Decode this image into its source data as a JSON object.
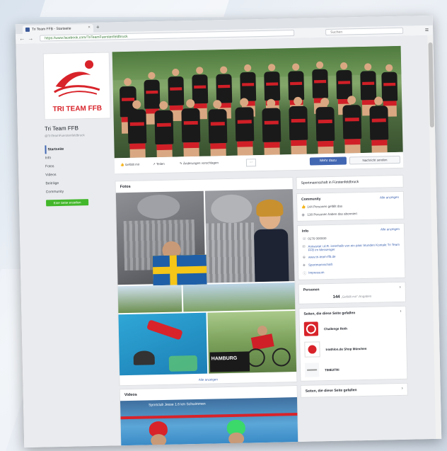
{
  "browser": {
    "tab_title": "Tri Team FFB - Startseite",
    "tab_close": "×",
    "new_tab": "+",
    "back": "←",
    "forward": "→",
    "url": "https://www.facebook.com/TriTeamFuerstenfeldbruck",
    "search_placeholder": "Suchen",
    "menu": "≡"
  },
  "sidebar": {
    "logo_text": "TRI TEAM FFB",
    "page_name": "Tri Team FFB",
    "handle": "@TriTeamFuerstenfeldbruck",
    "nav": [
      "Startseite",
      "Info",
      "Fotos",
      "Videos",
      "Beiträge",
      "Community"
    ],
    "create_button": "Eine Seite erstellen"
  },
  "actions": {
    "liked": "Gefällt mir",
    "share": "Teilen",
    "suggest": "Änderungen vorschlagen",
    "more": "···",
    "mehr_dazu": "Mehr dazu",
    "message": "Nachricht senden"
  },
  "photos": {
    "title": "Fotos",
    "show_all": "Alle anzeigen",
    "sign_text": "HAMBURG"
  },
  "videos": {
    "title": "Videos",
    "caption": "Sportclub Jesse 1.6 km Schwimmen"
  },
  "right": {
    "category": "Sportmannschaft in Fürstenfeldbruck",
    "community": {
      "title": "Community",
      "link": "Alle anzeigen",
      "likes": "144 Personen gefällt das",
      "follows": "138 Personen haben das abonniert"
    },
    "info": {
      "title": "Info",
      "link": "Alle anzeigen",
      "phone": "0176 000000",
      "reply": "Antwortet i.d.R. innerhalb von ein paar Stunden Kontakt Tri Team FFB im Messenger",
      "website": "www.tri-team-ffb.de",
      "category": "Sportmannschaft",
      "imprint": "Impressum"
    },
    "people": {
      "title": "Personen",
      "count": "144",
      "count_label": "„Gefällt mir“-Angaben"
    },
    "liked_pages": {
      "title": "Seiten, die diese Seite gefallen",
      "items": [
        "Challenge Roth",
        "triathlon.de Shop München",
        "TIME2TRI"
      ]
    },
    "liked_pages_2": {
      "title": "Seiten, die diese Seite gefallen"
    }
  },
  "colors": {
    "facebook_blue": "#4267b2",
    "brand_red": "#d8232a",
    "create_green": "#42b72a"
  }
}
